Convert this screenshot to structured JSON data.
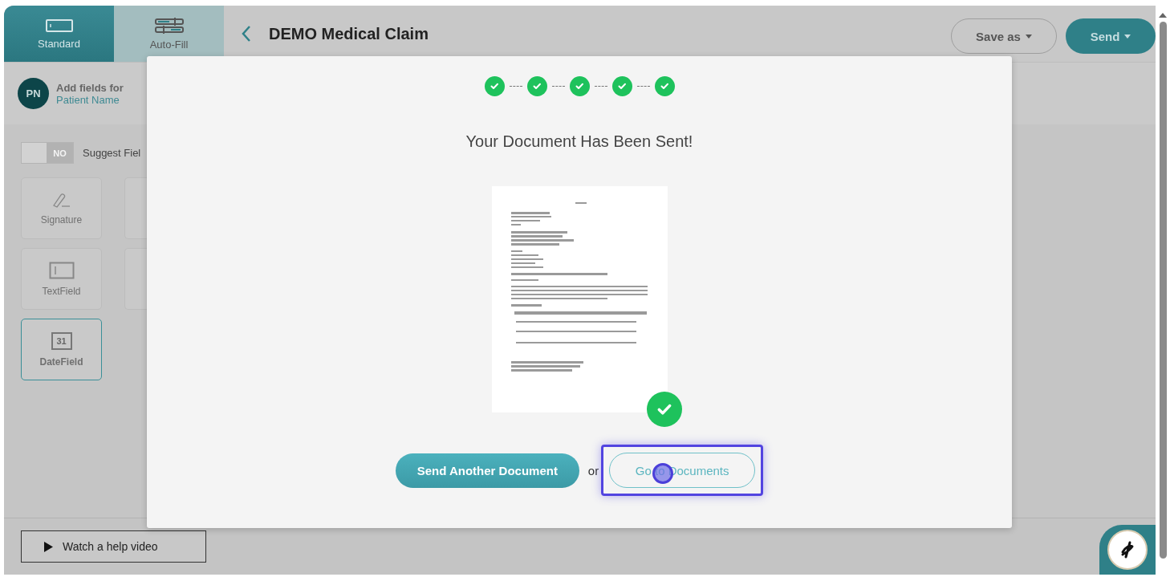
{
  "sidebar_tabs": [
    {
      "label": "Standard",
      "selected": true
    },
    {
      "label": "Auto-Fill",
      "selected": false
    }
  ],
  "header": {
    "title": "DEMO Medical Claim",
    "save_button": "Save as",
    "send_button": "Send"
  },
  "recipient": {
    "initials": "PN",
    "line1": "Add fields for",
    "name": "Patient Name"
  },
  "suggest": {
    "toggle_label": "NO",
    "on": false,
    "label": "Suggest Fiel"
  },
  "field_tiles": [
    {
      "label": "Signature",
      "kind": "signature",
      "selected": false
    },
    {
      "label": "TextField",
      "kind": "text",
      "selected": false
    },
    {
      "label": "DateField",
      "kind": "date",
      "icon_text": "31",
      "selected": true
    }
  ],
  "help_button": "Watch a help video",
  "modal": {
    "steps": [
      {
        "done": true
      },
      {
        "done": true
      },
      {
        "done": true
      },
      {
        "done": true
      },
      {
        "done": true
      }
    ],
    "title": "Your Document Has Been Sent!",
    "sent": true,
    "primary_button": "Send Another Document",
    "separator": "or",
    "secondary_button": {
      "label": "Go to Documents",
      "focused": true
    }
  }
}
